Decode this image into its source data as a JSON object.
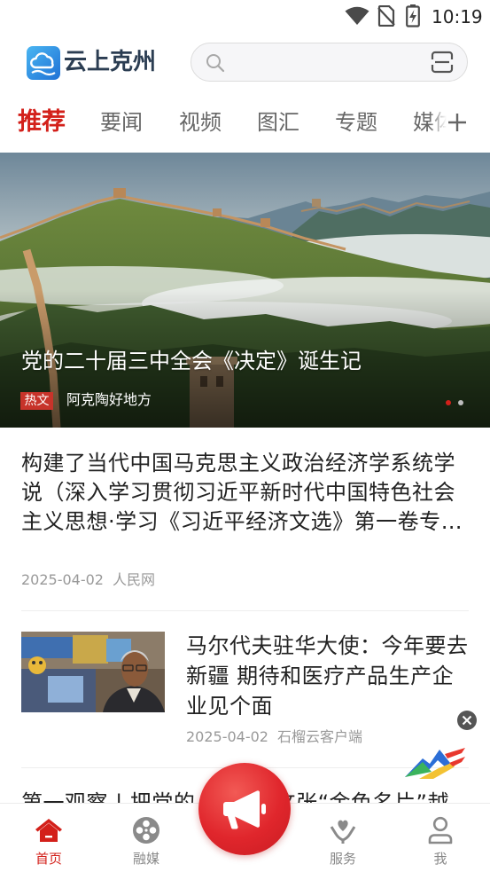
{
  "status_bar": {
    "time": "10:19",
    "icons": [
      "wifi-icon",
      "no-sim-icon",
      "battery-charging-icon"
    ]
  },
  "header": {
    "logo_icon": "cloud-logo-icon",
    "logo_text": "云上克州",
    "search_icons": [
      "search-icon",
      "scan-icon"
    ]
  },
  "tabs": [
    {
      "label": "推荐",
      "active": true
    },
    {
      "label": "要闻",
      "active": false
    },
    {
      "label": "视频",
      "active": false
    },
    {
      "label": "图汇",
      "active": false
    },
    {
      "label": "专题",
      "active": false
    },
    {
      "label": "媒体",
      "active": false
    }
  ],
  "tab_more_icon": "plus-icon",
  "banner": {
    "title": "党的二十届三中全会《决定》诞生记",
    "tag": "热文",
    "source": "阿克陶好地方",
    "slide_count": 2,
    "active_slide": 1
  },
  "articles": [
    {
      "title": "构建了当代中国马克思主义政治经济学系统学说（深入学习贯彻习近平新时代中国特色社会主义思想·学习《习近平经济文选》第一卷专…",
      "date": "2025-04-02",
      "source": "人民网"
    },
    {
      "title": "马尔代夫驻华大使：今年要去新疆 期待和医疗产品生产企业见个面",
      "date": "2025-04-02",
      "source": "石榴云客户端"
    }
  ],
  "partial_article": {
    "title_left": "第一观察 | 把党的",
    "title_right": "这张“金色名片”越"
  },
  "floating": {
    "close_icon": "close-icon",
    "logo_icon": "mountain-logo-icon"
  },
  "bottom_nav": {
    "items": [
      {
        "label": "首页",
        "icon": "home-icon",
        "active": true
      },
      {
        "label": "融媒",
        "icon": "film-reel-icon",
        "active": false
      },
      {
        "label": "服务",
        "icon": "heart-hand-icon",
        "active": false
      },
      {
        "label": "我",
        "icon": "person-icon",
        "active": false
      }
    ],
    "center_button_icon": "megaphone-icon"
  },
  "colors": {
    "accent": "#d3201a",
    "text": "#222222",
    "muted": "#999999",
    "tag_bg": "#c7332a"
  }
}
